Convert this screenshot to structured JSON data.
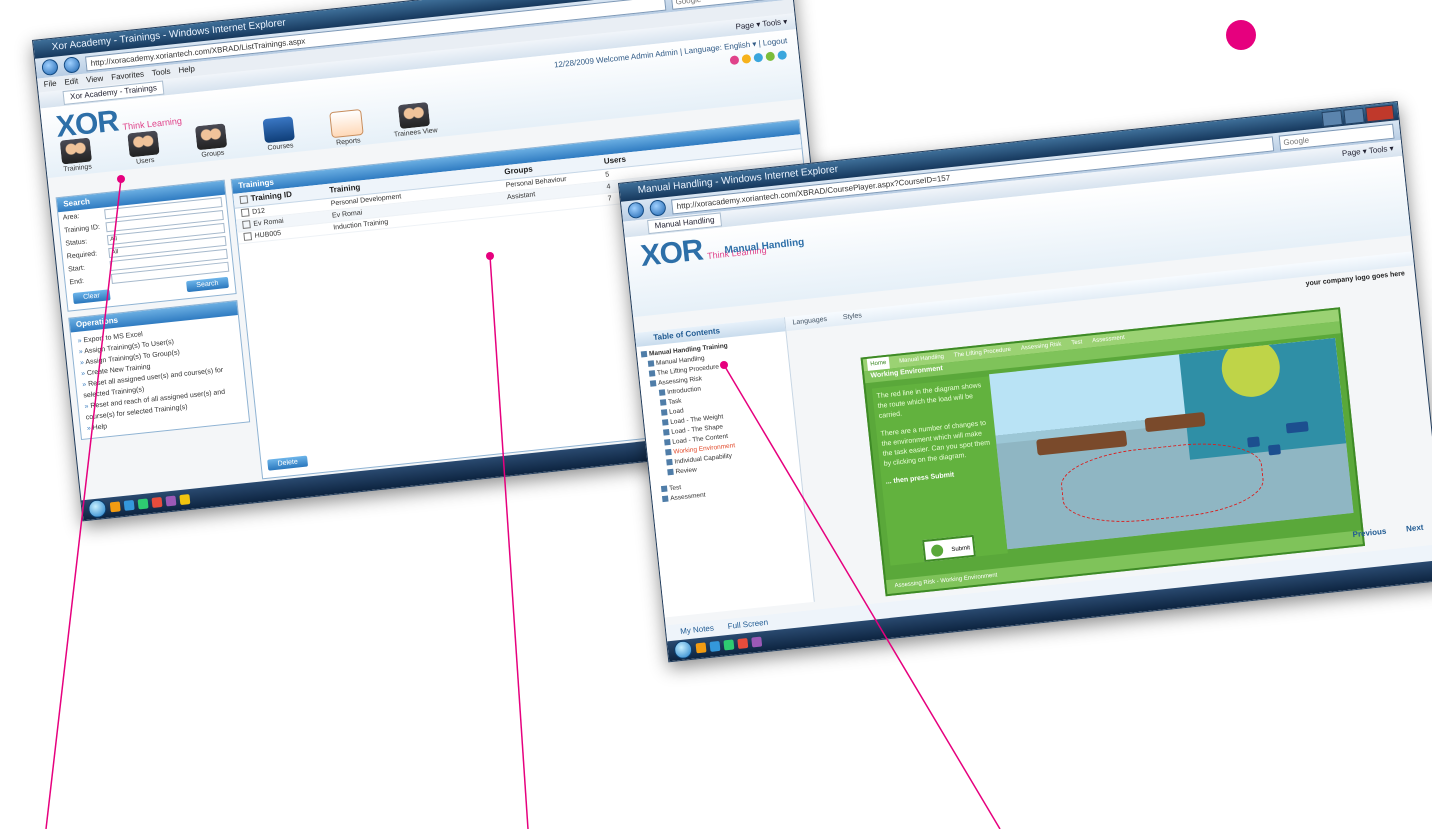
{
  "colors": {
    "accent_pink": "#e6007e",
    "ie_blue": "#2f7bc1",
    "lesson_green": "#5aa83a"
  },
  "screen1": {
    "window_title": "Xor Academy - Trainings - Windows Internet Explorer",
    "url": "http://xoracademy.xoriantech.com/XBRAD/ListTrainings.aspx",
    "search_placeholder": "Google",
    "menu": [
      "File",
      "Edit",
      "View",
      "Favorites",
      "Tools",
      "Help"
    ],
    "tab_label": "Xor Academy - Trainings",
    "page_tools": "Page ▾  Tools ▾",
    "welcome": "12/28/2009 Welcome Admin Admin  |  Language: English ▾  |  Logout",
    "logo": "XOR",
    "logo_tag": "Think Learning",
    "toolbar": [
      {
        "label": "Trainings",
        "icon": "people"
      },
      {
        "label": "Users",
        "icon": "people"
      },
      {
        "label": "Groups",
        "icon": "people"
      },
      {
        "label": "Courses",
        "icon": "courses"
      },
      {
        "label": "Reports",
        "icon": "reports"
      },
      {
        "label": "Trainees View",
        "icon": "people"
      }
    ],
    "search_panel": {
      "title": "Search",
      "fields": [
        {
          "label": "Area:"
        },
        {
          "label": "Training ID:"
        },
        {
          "label": "Status:",
          "value": "All"
        },
        {
          "label": "Required:",
          "value": "All"
        },
        {
          "label": "Start:"
        },
        {
          "label": "End:"
        }
      ],
      "clear_label": "Clear",
      "search_label": "Search"
    },
    "operations": {
      "title": "Operations",
      "items": [
        "Export to MS Excel",
        "Assign Training(s) To User(s)",
        "Assign Training(s) To Group(s)",
        "Create New Training",
        "Reset all assigned user(s) and course(s) for selected Training(s)",
        "Reset and reach of all assigned user(s) and course(s) for selected Training(s)",
        "Help"
      ]
    },
    "grid": {
      "title": "Trainings",
      "columns": [
        "Training ID",
        "Training",
        "Groups",
        "Users"
      ],
      "rows": [
        {
          "id": "D12",
          "training": "Personal Development",
          "groups": "Personal Behaviour",
          "users": "5"
        },
        {
          "id": "Ev Romai",
          "training": "Ev Romai",
          "groups": "Assistant",
          "users": "4"
        },
        {
          "id": "HUB005",
          "training": "Induction Training",
          "groups": "",
          "users": "7"
        }
      ],
      "delete_label": "Delete"
    }
  },
  "screen2": {
    "window_title": "Manual Handling - Windows Internet Explorer",
    "url": "http://xoracademy.xoriantech.com/XBRAD/CoursePlayer.aspx?CourseID=157",
    "search_placeholder": "Google",
    "tab_label": "Manual Handling",
    "page_tools": "Page ▾  Tools ▾",
    "logo": "XOR",
    "logo_tag": "Think Learning",
    "course_title": "Manual Handling",
    "toc_title": "Table of Contents",
    "tabs": [
      "Languages",
      "Styles"
    ],
    "brand_placeholder": "your company logo goes here",
    "toc": [
      {
        "label": "Manual Handling Training",
        "level": 0
      },
      {
        "label": "Manual Handling",
        "level": 1
      },
      {
        "label": "The Lifting Procedure",
        "level": 1
      },
      {
        "label": "Assessing Risk",
        "level": 1
      },
      {
        "label": "Introduction",
        "level": 2
      },
      {
        "label": "Task",
        "level": 2
      },
      {
        "label": "Load",
        "level": 2
      },
      {
        "label": "Load - The Weight",
        "level": 2
      },
      {
        "label": "Load - The Shape",
        "level": 2
      },
      {
        "label": "Load - The Content",
        "level": 2
      },
      {
        "label": "Working Environment",
        "level": 2,
        "selected": true
      },
      {
        "label": "Individual Capability",
        "level": 2
      },
      {
        "label": "Review",
        "level": 2
      },
      {
        "label": "Test",
        "level": 1
      },
      {
        "label": "Assessment",
        "level": 1
      }
    ],
    "lesson": {
      "tabs": [
        "Home",
        "Manual Handling",
        "The Lifting Procedure",
        "Assessing Risk",
        "Test",
        "Assessment"
      ],
      "title": "Working Environment",
      "instr_1": "The red line in the diagram shows the route which the load will be carried.",
      "instr_2": "There are a number of changes to the environment which will make the task easier. Can you spot them by clicking on the diagram.",
      "instr_3": "... then press Submit",
      "submit_label": "Submit",
      "footer": "Assessing Risk - Working Environment"
    },
    "previous_label": "Previous",
    "next_label": "Next",
    "bottom": [
      "My Notes",
      "Full Screen"
    ]
  }
}
